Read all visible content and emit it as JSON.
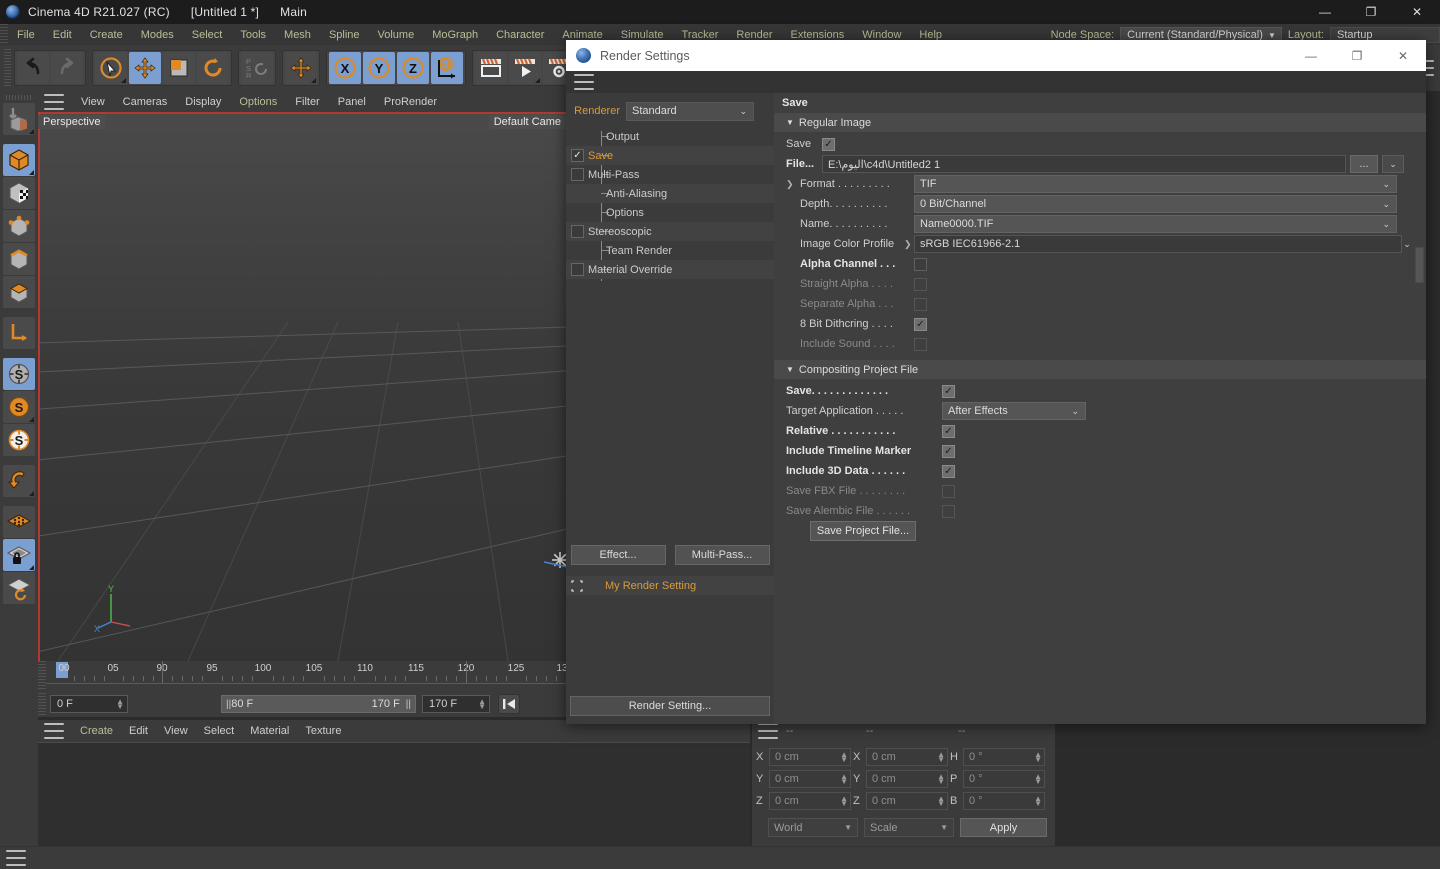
{
  "app": {
    "title_name": "Cinema 4D R21.027 (RC)",
    "title_doc": "[Untitled 1 *]",
    "title_layout": "Main",
    "logo_icon": "c4d-logo-icon",
    "window_buttons": {
      "minimize": "—",
      "maximize": "❐",
      "close": "✕"
    }
  },
  "menubar": {
    "items": [
      "File",
      "Edit",
      "Create",
      "Modes",
      "Select",
      "Tools",
      "Mesh",
      "Spline",
      "Volume",
      "MoGraph",
      "Character",
      "Animate",
      "Simulate",
      "Tracker",
      "Render",
      "Extensions",
      "Window",
      "Help"
    ],
    "node_space_label": "Node Space:",
    "node_space_value": "Current (Standard/Physical)",
    "layout_label": "Layout:",
    "layout_value": "Startup"
  },
  "toolbar": {
    "groups": [
      {
        "name": "history",
        "buttons": [
          {
            "icon": "undo-icon",
            "active": false,
            "corner": false
          },
          {
            "icon": "redo-icon",
            "active": false,
            "corner": false
          }
        ]
      },
      {
        "name": "transform",
        "buttons": [
          {
            "icon": "select-cursor-icon",
            "active": false,
            "corner": true
          },
          {
            "icon": "move-icon",
            "active": true,
            "corner": false
          },
          {
            "icon": "scale-icon",
            "active": false,
            "corner": false
          },
          {
            "icon": "rotate-icon",
            "active": false,
            "corner": false
          }
        ]
      },
      {
        "name": "psr",
        "buttons": [
          {
            "icon": "psr-icon",
            "active": false,
            "corner": false
          }
        ]
      },
      {
        "name": "move-axis",
        "buttons": [
          {
            "icon": "move-world-icon",
            "active": false,
            "corner": true
          }
        ]
      },
      {
        "name": "axis-locks",
        "buttons": [
          {
            "icon": "axis-x-icon",
            "active": true,
            "corner": false
          },
          {
            "icon": "axis-y-icon",
            "active": true,
            "corner": false
          },
          {
            "icon": "axis-z-icon",
            "active": true,
            "corner": false
          },
          {
            "icon": "world-coord-icon",
            "active": true,
            "corner": false
          }
        ]
      },
      {
        "name": "render",
        "buttons": [
          {
            "icon": "render-view-icon",
            "active": false,
            "corner": false
          },
          {
            "icon": "render-to-picture-viewer-icon",
            "active": false,
            "corner": true
          },
          {
            "icon": "render-settings-icon",
            "active": false,
            "corner": false
          }
        ]
      }
    ]
  },
  "left_palette": {
    "items": [
      {
        "icon": "make-editable-icon",
        "active": false,
        "corner": true
      },
      {
        "icon": "model-mode-icon",
        "active": true,
        "corner": true
      },
      {
        "icon": "texture-mode-icon",
        "active": false,
        "corner": false
      },
      {
        "icon": "points-mode-icon",
        "active": false,
        "corner": false
      },
      {
        "icon": "edges-mode-icon",
        "active": false,
        "corner": false
      },
      {
        "icon": "polygons-mode-icon",
        "active": false,
        "corner": false
      },
      {
        "icon": "axis-modify-icon",
        "active": false,
        "corner": false
      },
      {
        "icon": "enable-snap-grey-icon",
        "active": true,
        "corner": false
      },
      {
        "icon": "snap-orange-icon",
        "active": false,
        "corner": true
      },
      {
        "icon": "snap-white-icon",
        "active": false,
        "corner": false
      },
      {
        "icon": "workplane-icon",
        "active": false,
        "corner": true
      },
      {
        "icon": "grid-plane-icon",
        "active": false,
        "corner": false
      },
      {
        "icon": "lock-workplane-icon",
        "active": true,
        "corner": true
      },
      {
        "icon": "workplane-rotate-icon",
        "active": false,
        "corner": false
      }
    ]
  },
  "viewport": {
    "menu": [
      "View",
      "Cameras",
      "Display",
      "Options",
      "Filter",
      "Panel",
      "ProRender"
    ],
    "menu_highlight": "Options",
    "label_left": "Perspective",
    "label_right": "Default Came",
    "hamburger_icon": "viewport-menu-icon",
    "axis": {
      "x": "X",
      "y": "Y",
      "z": "Z"
    },
    "light_marker_icon": "light-marker-icon"
  },
  "timeline": {
    "labels": [
      "00",
      "05",
      "90",
      "95",
      "100",
      "105",
      "110",
      "115",
      "120",
      "125",
      "13"
    ],
    "playhead_frame": "0 F",
    "preview_range_start": "80 F",
    "preview_range_end": "170 F",
    "max_frame": "170 F"
  },
  "material_manager": {
    "menu": [
      "Create",
      "Edit",
      "View",
      "Select",
      "Material",
      "Texture"
    ],
    "hamburger_icon": "material-menu-icon"
  },
  "coordinates": {
    "hamburger_icon": "coordinates-menu-icon",
    "headers": [
      "--",
      "--",
      "--"
    ],
    "position": {
      "labels": [
        "X",
        "Y",
        "Z"
      ],
      "values": [
        "0 cm",
        "0 cm",
        "0 cm"
      ]
    },
    "size": {
      "labels": [
        "X",
        "Y",
        "Z"
      ],
      "values": [
        "0 cm",
        "0 cm",
        "0 cm"
      ]
    },
    "rotation": {
      "labels": [
        "H",
        "P",
        "B"
      ],
      "values": [
        "0 °",
        "0 °",
        "0 °"
      ]
    },
    "system": "World",
    "mode": "Scale",
    "apply": "Apply"
  },
  "render_settings": {
    "window_title": "Render Settings",
    "window_icon": "render-settings-window-icon",
    "window_buttons": {
      "minimize": "—",
      "maximize": "❐",
      "close": "✕"
    },
    "menu_icon": "dialog-menu-icon",
    "renderer_label": "Renderer",
    "renderer_value": "Standard",
    "tree": [
      {
        "label": "Output",
        "checkbox": "none",
        "selected": false
      },
      {
        "label": "Save",
        "checkbox": "checked",
        "selected": true
      },
      {
        "label": "Multi-Pass",
        "checkbox": "unchecked",
        "selected": false
      },
      {
        "label": "Anti-Aliasing",
        "checkbox": "none",
        "selected": false
      },
      {
        "label": "Options",
        "checkbox": "none",
        "selected": false
      },
      {
        "label": "Stereoscopic",
        "checkbox": "unchecked",
        "selected": false
      },
      {
        "label": "Team Render",
        "checkbox": "none",
        "selected": false
      },
      {
        "label": "Material Override",
        "checkbox": "unchecked",
        "selected": false
      }
    ],
    "effect_button": "Effect...",
    "multipass_button": "Multi-Pass...",
    "preset_name": "My Render Setting",
    "preset_icon": "render-preset-icon",
    "render_setting_button": "Render Setting...",
    "pane_title": "Save",
    "group_regular_image": "Regular Image",
    "group_compositing": "Compositing Project File",
    "regular_image": {
      "save_label": "Save",
      "save_checked": true,
      "file_label": "File...",
      "file_value": "E:\\اليوم\\c4d\\Untitled2 1",
      "file_browse_button": "...",
      "format_label": "Format . . . . . . . . .",
      "format_value": "TIF",
      "depth_label": "Depth. . . . . . . . . .",
      "depth_value": "0 Bit/Channel",
      "name_label": "Name. . . . . . . . . .",
      "name_value": "Name0000.TIF",
      "color_profile_label": "Image Color Profile",
      "color_profile_value": "sRGB IEC61966-2.1",
      "alpha_channel_label": "Alpha Channel . . .",
      "alpha_channel_checked": false,
      "straight_alpha_label": "Straight Alpha . . . .",
      "straight_alpha_checked": false,
      "separate_alpha_label": "Separate Alpha . . .",
      "separate_alpha_checked": false,
      "dithering_label": "8 Bit Dithcring . . . .",
      "dithering_checked": true,
      "include_sound_label": "Include Sound . . . .",
      "include_sound_checked": false
    },
    "compositing": {
      "save_label": "Save. . . . . . . . . . . . .",
      "save_checked": true,
      "target_app_label": "Target Application . . . . .",
      "target_app_value": "After Effects",
      "relative_label": "Relative . . . . . . . . . . .",
      "relative_checked": true,
      "timeline_marker_label": "Include Timeline Marker",
      "timeline_marker_checked": true,
      "data3d_label": "Include 3D Data . . . . . .",
      "data3d_checked": true,
      "fbx_label": "Save FBX File . . . . . . . .",
      "fbx_checked": false,
      "alembic_label": "Save Alembic File . . . . . .",
      "alembic_checked": false,
      "save_project_button": "Save Project File..."
    }
  },
  "colors": {
    "accent_orange": "#d99b3c",
    "menu_text": "#b9bf96",
    "selected_blue": "#7c9fd1",
    "panel_bg": "#3b3b3b",
    "dialog_bg": "#3f3f3f"
  }
}
